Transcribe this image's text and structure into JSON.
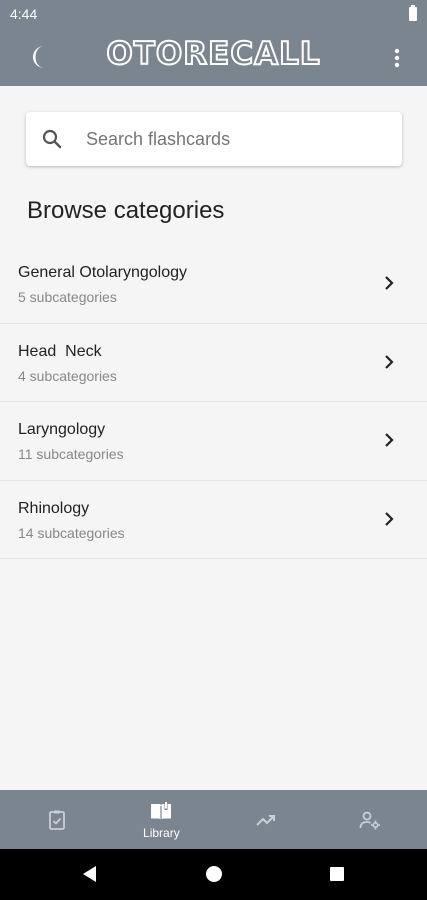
{
  "status_bar": {
    "time": "4:44"
  },
  "app_bar": {
    "title": "OTORECALL"
  },
  "search": {
    "placeholder": "Search flashcards",
    "value": ""
  },
  "section_title": "Browse categories",
  "categories": [
    {
      "name": "General Otolaryngology",
      "subcategories": "5 subcategories"
    },
    {
      "name": "Head  Neck",
      "subcategories": "4 subcategories"
    },
    {
      "name": "Laryngology",
      "subcategories": "11 subcategories"
    },
    {
      "name": "Rhinology",
      "subcategories": "14 subcategories"
    }
  ],
  "bottom_nav": {
    "items": [
      {
        "icon": "clipboard-check-icon",
        "label": ""
      },
      {
        "icon": "book-open-icon",
        "label": "Library",
        "active": true
      },
      {
        "icon": "trending-up-icon",
        "label": ""
      },
      {
        "icon": "user-settings-icon",
        "label": ""
      }
    ]
  },
  "colors": {
    "bar": "#7a858f",
    "background": "#f5f5f5",
    "text": "#222222",
    "subtext": "#888888"
  }
}
